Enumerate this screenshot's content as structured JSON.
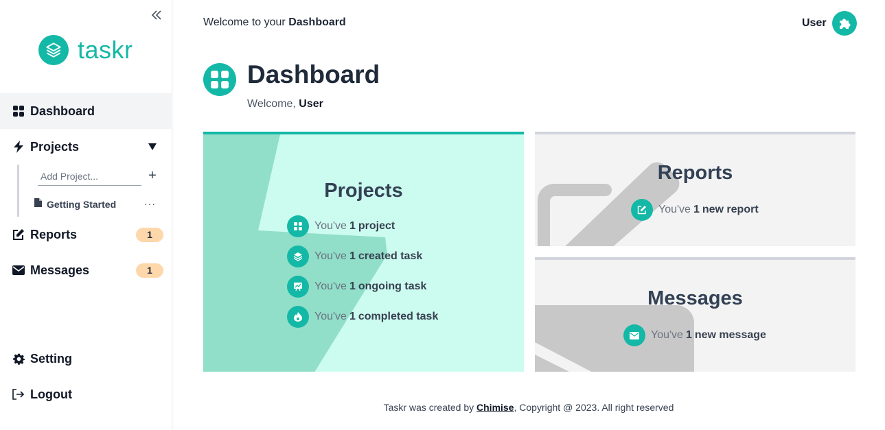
{
  "app": {
    "name": "taskr"
  },
  "colors": {
    "accent": "#14b8a6",
    "badge": "#fed7aa",
    "projects_card": "#ccfbef",
    "card_gray": "#f3f3f3"
  },
  "sidebar": {
    "items": [
      {
        "label": "Dashboard",
        "icon": "grid-icon"
      },
      {
        "label": "Projects",
        "icon": "bolt-icon"
      },
      {
        "label": "Reports",
        "icon": "edit-icon",
        "badge": "1"
      },
      {
        "label": "Messages",
        "icon": "envelope-icon",
        "badge": "1"
      },
      {
        "label": "Setting",
        "icon": "gear-icon"
      },
      {
        "label": "Logout",
        "icon": "logout-icon"
      }
    ],
    "projects": {
      "add_placeholder": "Add Project...",
      "items": [
        {
          "label": "Getting Started",
          "icon": "file-icon"
        }
      ]
    }
  },
  "header": {
    "welcome_prefix": "Welcome to your ",
    "welcome_strong": "Dashboard",
    "user_name": "User"
  },
  "page": {
    "title": "Dashboard",
    "subtitle_prefix": "Welcome, ",
    "subtitle_user": "User"
  },
  "cards": {
    "projects": {
      "title": "Projects",
      "stats": [
        {
          "prefix": "You've",
          "count": "1",
          "suffix": "project",
          "icon": "grid-icon"
        },
        {
          "prefix": "You've",
          "count": "1",
          "suffix": "created task",
          "icon": "layers-icon"
        },
        {
          "prefix": "You've",
          "count": "1",
          "suffix": "ongoing task",
          "icon": "chart-board-icon"
        },
        {
          "prefix": "You've",
          "count": "1",
          "suffix": "completed task",
          "icon": "fire-icon"
        }
      ]
    },
    "reports": {
      "title": "Reports",
      "stat": {
        "prefix": "You've",
        "count": "1",
        "suffix": "new report",
        "icon": "edit-icon"
      }
    },
    "messages": {
      "title": "Messages",
      "stat": {
        "prefix": "You've",
        "count": "1",
        "suffix": "new message",
        "icon": "envelope-icon"
      }
    }
  },
  "footer": {
    "prefix": "Taskr was created by ",
    "author": "Chimise",
    "suffix": ", Copyright @ 2023. All right reserved"
  }
}
